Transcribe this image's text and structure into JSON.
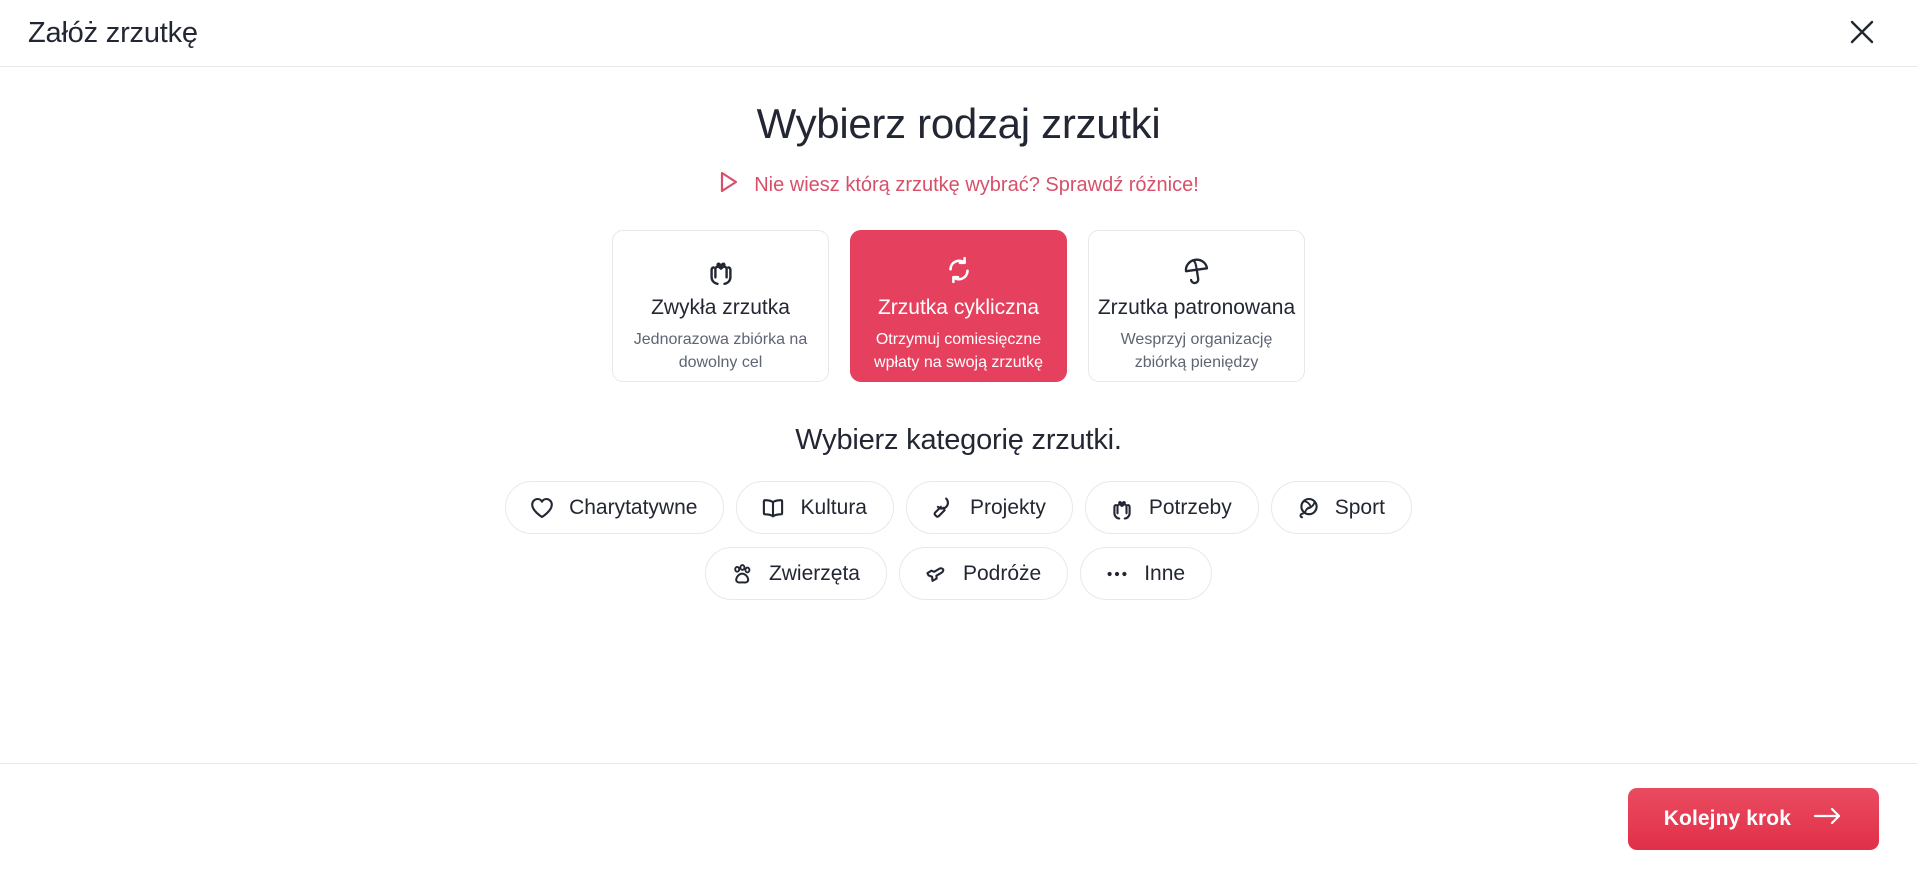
{
  "header": {
    "title": "Załóż zrzutkę",
    "close_icon": "close-icon"
  },
  "main": {
    "heading": "Wybierz rodzaj zrzutki",
    "difference_link": {
      "icon": "play-triangle-icon",
      "label": "Nie wiesz którą zrzutkę wybrać? Sprawdź różnice!"
    },
    "type_cards": [
      {
        "icon": "hands-heart-icon",
        "title": "Zwykła zrzutka",
        "desc": "Jednorazowa zbiórka na dowolny cel",
        "selected": false
      },
      {
        "icon": "refresh-cycle-icon",
        "title": "Zrzutka cykliczna",
        "desc": "Otrzymuj comiesięczne wpłaty na swoją zrzutkę",
        "selected": true
      },
      {
        "icon": "umbrella-icon",
        "title": "Zrzutka patronowana",
        "desc": "Wesprzyj organizację zbiórką pieniędzy",
        "selected": false
      }
    ],
    "category_heading": "Wybierz kategorię zrzutki.",
    "categories_row1": [
      {
        "icon": "heart-icon",
        "label": "Charytatywne"
      },
      {
        "icon": "book-icon",
        "label": "Kultura"
      },
      {
        "icon": "paint-roller-icon",
        "label": "Projekty"
      },
      {
        "icon": "hands-heart-icon",
        "label": "Potrzeby"
      },
      {
        "icon": "ball-icon",
        "label": "Sport"
      }
    ],
    "categories_row2": [
      {
        "icon": "paw-icon",
        "label": "Zwierzęta"
      },
      {
        "icon": "airplane-icon",
        "label": "Podróże"
      },
      {
        "icon": "ellipsis-icon",
        "label": "Inne"
      }
    ]
  },
  "footer": {
    "next_label": "Kolejny krok",
    "next_icon": "arrow-right-icon"
  },
  "colors": {
    "accent": "#e5415f",
    "accent_link": "#d7506a",
    "text": "#232733",
    "muted_text": "#5e6472",
    "border": "#e6e8ec",
    "button_gradient_top": "#ea4b60",
    "button_gradient_bottom": "#e03049"
  }
}
